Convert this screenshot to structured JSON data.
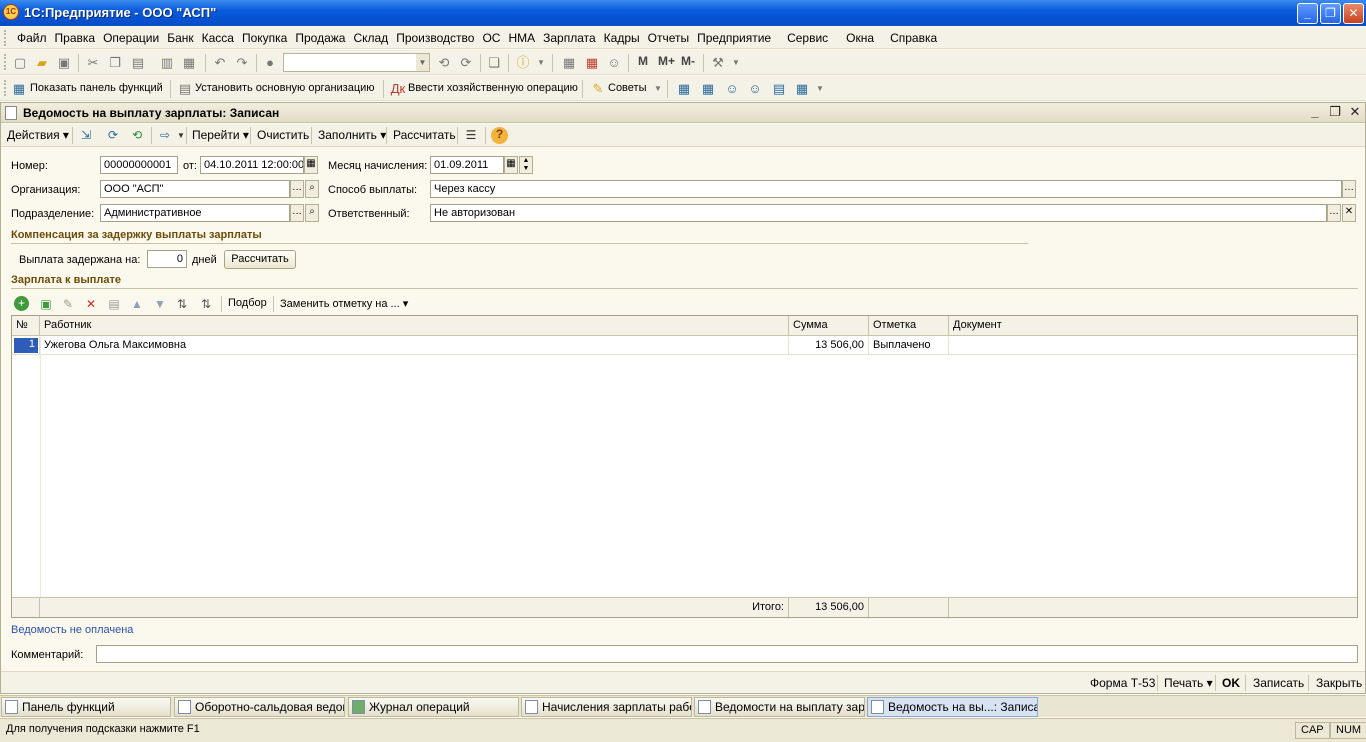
{
  "window": {
    "title": "1С:Предприятие - ООО \"АСП\""
  },
  "menu": [
    "Файл",
    "Правка",
    "Операции",
    "Банк",
    "Касса",
    "Покупка",
    "Продажа",
    "Склад",
    "Производство",
    "ОС",
    "НМА",
    "Зарплата",
    "Кадры",
    "Отчеты",
    "Предприятие",
    "Сервис",
    "Окна",
    "Справка"
  ],
  "toolbar2": {
    "show_panel": "Показать панель функций",
    "set_org": "Установить основную организацию",
    "enter_op": "Ввести хозяйственную операцию",
    "tips": "Советы"
  },
  "toolbar1": {
    "m": "M",
    "mplus": "M+",
    "mminus": "M-"
  },
  "doc": {
    "title": "Ведомость на выплату зарплаты: Записан",
    "actions": "Действия",
    "goto": "Перейти",
    "clear": "Очистить",
    "fill": "Заполнить",
    "calc": "Рассчитать"
  },
  "form": {
    "number_label": "Номер:",
    "number": "00000000001",
    "from_label": "от:",
    "date": "04.10.2011 12:00:00",
    "month_label": "Месяц начисления:",
    "month": "01.09.2011",
    "org_label": "Организация:",
    "org": "ООО \"АСП\"",
    "pay_method_label": "Способ выплаты:",
    "pay_method": "Через кассу",
    "dept_label": "Подразделение:",
    "dept": "Административное",
    "responsible_label": "Ответственный:",
    "responsible": "Не авторизован"
  },
  "compensation": {
    "title": "Компенсация за задержку выплаты зарплаты",
    "delay_label": "Выплата задержана на:",
    "delay_value": "0",
    "days": "дней",
    "calc_button": "Рассчитать"
  },
  "salary": {
    "title": "Зарплата к выплате",
    "pick": "Подбор",
    "replace_mark": "Заменить отметку на ...",
    "columns": [
      "№",
      "Работник",
      "Сумма",
      "Отметка",
      "Документ"
    ],
    "rows": [
      {
        "num": "1",
        "employee": "Ужегова Ольга Максимовна",
        "sum": "13 506,00",
        "mark": "Выплачено",
        "doc": ""
      }
    ],
    "total_label": "Итого:",
    "total": "13 506,00"
  },
  "status_link": "Ведомость не оплачена",
  "comment_label": "Комментарий:",
  "comment": "",
  "bottom": {
    "form_t53": "Форма Т-53",
    "print": "Печать",
    "ok": "OK",
    "save": "Записать",
    "close": "Закрыть"
  },
  "wintabs": [
    "Панель функций",
    "Оборотно-сальдовая ведом...",
    "Журнал операций",
    "Начисления зарплаты рабо...",
    "Ведомости на выплату зар...",
    "Ведомость на вы...: Записан"
  ],
  "statusbar": {
    "hint": "Для получения подсказки нажмите F1",
    "cap": "CAP",
    "num": "NUM"
  }
}
